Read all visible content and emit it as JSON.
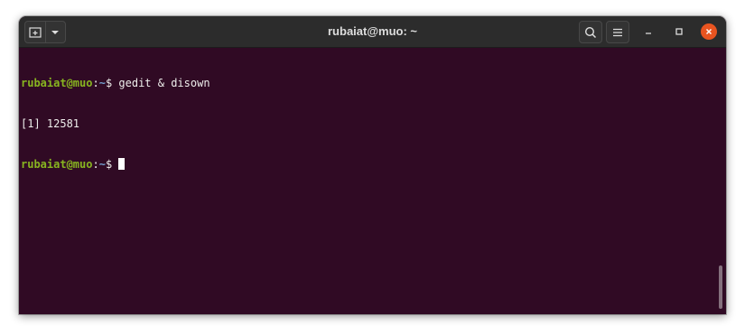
{
  "window": {
    "title": "rubaiat@muo: ~"
  },
  "toolbar": {
    "new_tab_icon": "new-tab-icon",
    "tab_menu_icon": "chevron-down-icon",
    "search_icon": "search-icon",
    "menu_icon": "hamburger-menu-icon",
    "minimize_icon": "minimize-icon",
    "maximize_icon": "maximize-icon",
    "close_icon": "close-icon"
  },
  "terminal": {
    "lines": [
      {
        "user": "rubaiat@muo",
        "sep": ":",
        "path": "~",
        "prompt": "$ ",
        "command": "gedit & disown"
      },
      {
        "output": "[1] 12581"
      },
      {
        "user": "rubaiat@muo",
        "sep": ":",
        "path": "~",
        "prompt": "$ ",
        "command": ""
      }
    ]
  },
  "colors": {
    "background": "#300a24",
    "titlebar": "#2c2c2c",
    "user": "#88b520",
    "path": "#729fcf",
    "close": "#e95420"
  }
}
